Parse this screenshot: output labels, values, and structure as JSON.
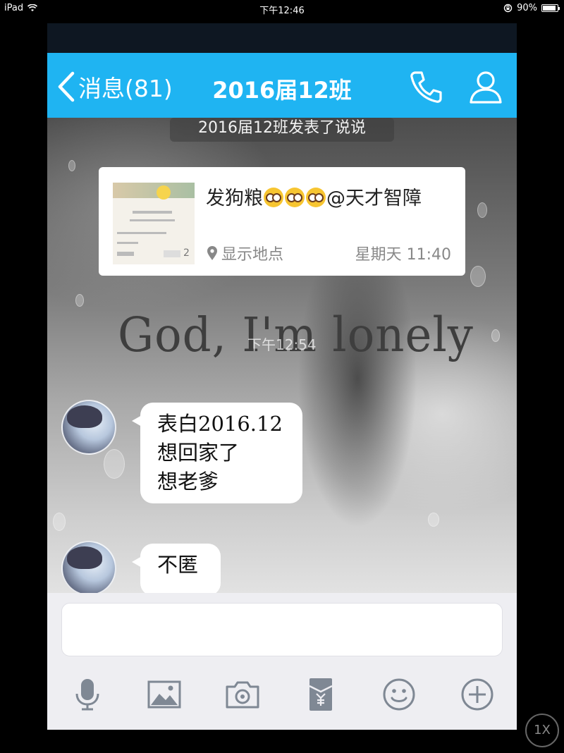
{
  "status_bar": {
    "device": "iPad",
    "time": "下午12:46",
    "battery_text": "90%",
    "battery_level": 0.9
  },
  "nav": {
    "back_label": "消息(81)",
    "title": "2016届12班",
    "accent_color": "#1fb4f2"
  },
  "chat": {
    "notice": "2016届12班发表了说说",
    "card": {
      "text": "发狗粮",
      "mention": "@天才智障",
      "emoji_count": 3,
      "location_label": "显示地点",
      "time": "星期天 11:40",
      "thumb_count": "2"
    },
    "background_text": "God, I'm lonely",
    "timestamp": "下午12:54",
    "messages": [
      {
        "lines": [
          "表白2016.12",
          "想回家了",
          "想老爹"
        ]
      },
      {
        "lines": [
          "不匿"
        ]
      }
    ]
  },
  "toolbar": {
    "icons": [
      "microphone-icon",
      "image-icon",
      "camera-icon",
      "red-packet-icon",
      "emoji-icon",
      "plus-icon"
    ]
  },
  "zoom_label": "1X"
}
